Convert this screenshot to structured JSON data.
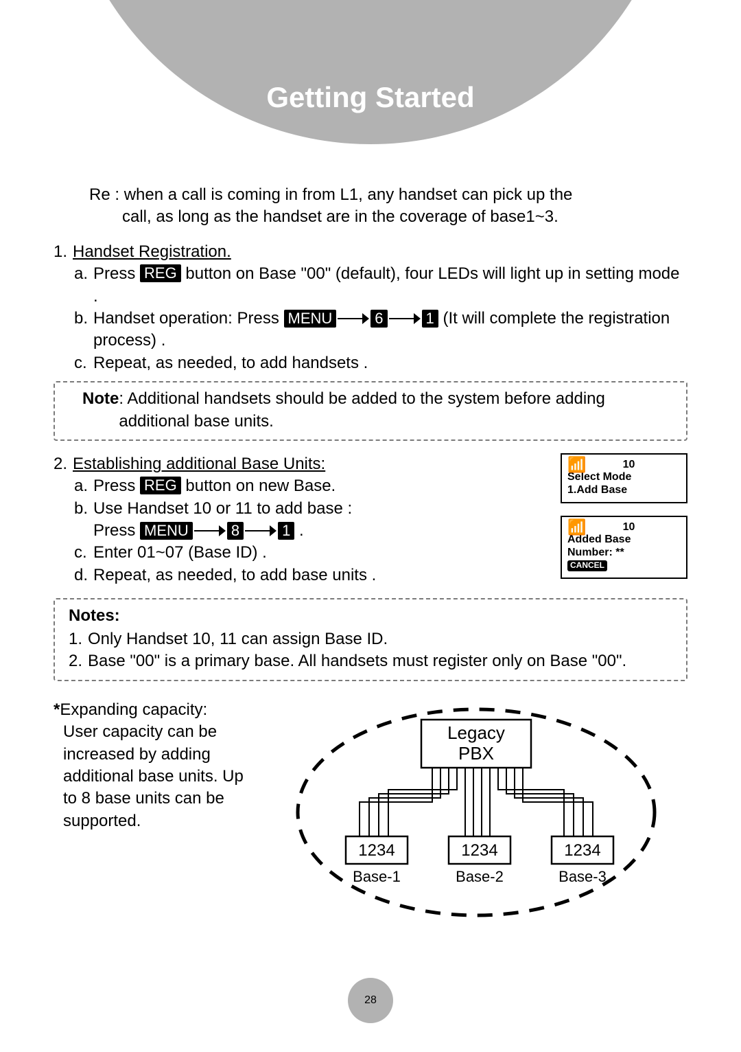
{
  "header": {
    "title": "Getting Started"
  },
  "intro": {
    "re_label": "Re : ",
    "re_line1": "when a call is coming in from L1, any handset can pick up the",
    "re_line2": "call, as long as the handset are in the coverage of base1~3."
  },
  "section1": {
    "num": "1.",
    "title": "Handset Registration.",
    "a": {
      "letter": "a.",
      "pre": "Press",
      "key": "REG",
      "post": " button on Base \"00\" (default), four LEDs will light up in setting mode ."
    },
    "b": {
      "letter": "b.",
      "pre": "Handset operation: Press ",
      "k1": "MENU",
      "k2": "6",
      "k3": "1",
      "post": " (It will complete the registration process) ."
    },
    "c": {
      "letter": "c.",
      "text": "Repeat, as needed, to add handsets ."
    }
  },
  "note1": {
    "label": "Note",
    "text": ": Additional handsets should be added to the system before adding additional base units."
  },
  "section2": {
    "num": "2.",
    "title": "Establishing additional Base Units:",
    "a": {
      "letter": "a.",
      "pre": "Press",
      "key": "REG",
      "post": " button on new Base."
    },
    "b": {
      "letter": "b.",
      "line1": "Use Handset 10 or 11 to add base :",
      "pre2": "Press",
      "k1": "MENU",
      "k2": "8",
      "k3": "1",
      "post2": " ."
    },
    "c": {
      "letter": "c.",
      "text": "Enter 01~07 (Base ID) ."
    },
    "d": {
      "letter": "d.",
      "text": "Repeat, as needed, to add base units ."
    }
  },
  "screens": {
    "s1": {
      "hn": "10",
      "l1": "Select Mode",
      "l2": "1.Add Base"
    },
    "s2": {
      "hn": "10",
      "l1": "Added Base",
      "l2": "Number: **",
      "cancel": "CANCEL"
    }
  },
  "notes2": {
    "heading": "Notes:",
    "n1": {
      "num": "1.",
      "text": "Only Handset 10, 11 can assign Base ID."
    },
    "n2": {
      "num": "2.",
      "text": "Base \"00\" is a primary base. All handsets must register only on Base \"00\"."
    }
  },
  "expand": {
    "star": "*",
    "title": "Expanding capacity:",
    "body": "User capacity can be increased by adding additional base units. Up to 8 base units can be supported."
  },
  "diagram": {
    "pbx": "Legacy\nPBX",
    "ports": "1234",
    "b1": "Base-1",
    "b2": "Base-2",
    "b3": "Base-3"
  },
  "page_number": "28"
}
